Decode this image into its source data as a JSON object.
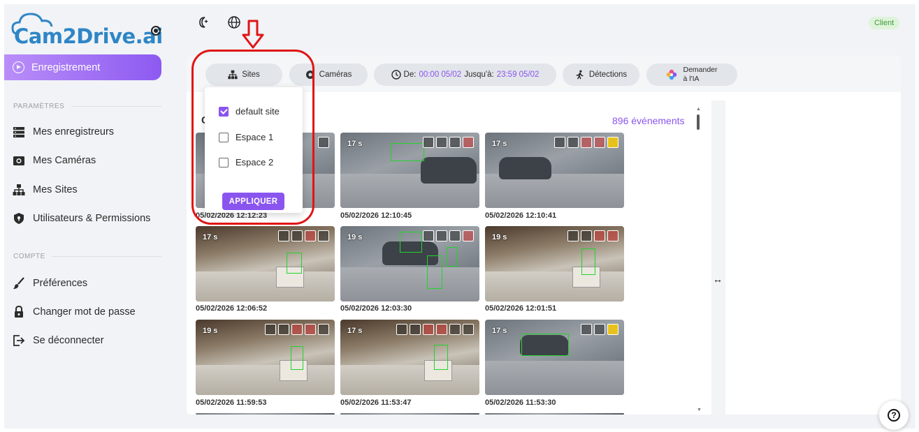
{
  "brand": {
    "logo_text": "Cam2Drive.ai"
  },
  "sidebar": {
    "active_item": "Enregistrement",
    "section_settings": "PARAMÈTRES",
    "settings_items": [
      {
        "label": "Mes enregistreurs",
        "icon": "server-icon"
      },
      {
        "label": "Mes Caméras",
        "icon": "camera-icon"
      },
      {
        "label": "Mes Sites",
        "icon": "sitemap-icon"
      },
      {
        "label": "Utilisateurs & Permissions",
        "icon": "shield-icon"
      }
    ],
    "section_account": "COMPTE",
    "account_items": [
      {
        "label": "Préférences",
        "icon": "brush-icon"
      },
      {
        "label": "Changer mot de passe",
        "icon": "lock-icon"
      },
      {
        "label": "Se déconnecter",
        "icon": "logout-icon"
      }
    ]
  },
  "topbar": {
    "badge": "Client"
  },
  "filters": {
    "sites": "Sites",
    "cameras": "Caméras",
    "date_from_label": "De:",
    "date_from": "00:00 05/02",
    "date_to_label": "Jusqu'à:",
    "date_to": "23:59 05/02",
    "detections": "Détections",
    "ask_ai_line1": "Demander",
    "ask_ai_line2": "à l'IA"
  },
  "dropdown": {
    "options": [
      {
        "label": "default site",
        "checked": true
      },
      {
        "label": "Espace 1",
        "checked": false
      },
      {
        "label": "Espace 2",
        "checked": false
      }
    ],
    "apply": "APPLIQUER"
  },
  "events": {
    "count_text": "896 événements",
    "group_letter": "C",
    "items": [
      {
        "duration": "",
        "time": "05/02/2026 12:12:23"
      },
      {
        "duration": "17 s",
        "time": "05/02/2026 12:10:45"
      },
      {
        "duration": "17 s",
        "time": "05/02/2026 12:10:41"
      },
      {
        "duration": "17 s",
        "time": "05/02/2026 12:06:52"
      },
      {
        "duration": "19 s",
        "time": "05/02/2026 12:03:30"
      },
      {
        "duration": "19 s",
        "time": "05/02/2026 12:01:51"
      },
      {
        "duration": "19 s",
        "time": "05/02/2026 11:59:53"
      },
      {
        "duration": "17 s",
        "time": "05/02/2026 11:53:47"
      },
      {
        "duration": "17 s",
        "time": "05/02/2026 11:53:30"
      }
    ]
  },
  "colors": {
    "accent": "#8a55ef",
    "annotation": "#e01515",
    "detection_box": "#22d32e"
  }
}
